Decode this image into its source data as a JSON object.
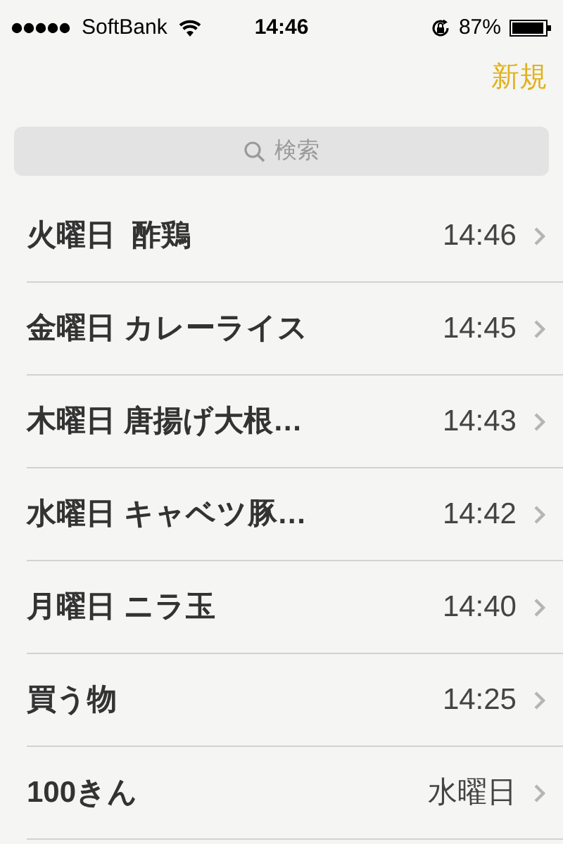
{
  "status_bar": {
    "carrier": "SoftBank",
    "time": "14:46",
    "battery": "87%"
  },
  "nav_bar": {
    "new_button": "新規"
  },
  "search": {
    "placeholder": "検索"
  },
  "notes": [
    {
      "title": "火曜日  酢鶏",
      "date": "14:46"
    },
    {
      "title": "金曜日 カレーライス",
      "date": "14:45"
    },
    {
      "title": "木曜日 唐揚げ大根…",
      "date": "14:43"
    },
    {
      "title": "水曜日 キャベツ豚…",
      "date": "14:42"
    },
    {
      "title": "月曜日 ニラ玉",
      "date": "14:40"
    },
    {
      "title": "買う物",
      "date": "14:25"
    },
    {
      "title": "100きん",
      "date": "水曜日"
    }
  ]
}
